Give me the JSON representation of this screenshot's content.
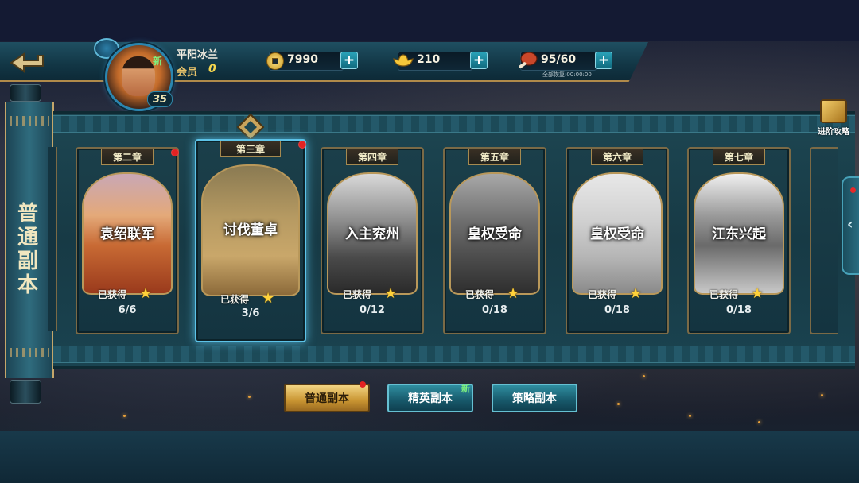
{
  "player": {
    "name": "平阳冰兰",
    "vip_label": "会员",
    "vip_level": "0",
    "level": "35",
    "avatar_badge": "新"
  },
  "resources": {
    "copper": {
      "value": "7990",
      "icon": "coin-icon"
    },
    "gold": {
      "value": "210",
      "icon": "gold-ingot-icon"
    },
    "stamina": {
      "value": "95/60",
      "recover_text": "全部恢复:00:00:00",
      "icon": "meat-icon"
    }
  },
  "panel": {
    "mode_title": "普通副本",
    "guide_label": "进阶攻略"
  },
  "chapters": [
    {
      "chapter": "第二章",
      "name": "袁绍联军",
      "obtained_label": "已获得",
      "progress": "6/6",
      "red_dot": true,
      "state": "cleared"
    },
    {
      "chapter": "第三章",
      "name": "讨伐董卓",
      "obtained_label": "已获得",
      "progress": "3/6",
      "red_dot": true,
      "state": "selected"
    },
    {
      "chapter": "第四章",
      "name": "入主兖州",
      "obtained_label": "已获得",
      "progress": "0/12",
      "red_dot": false,
      "state": "locked"
    },
    {
      "chapter": "第五章",
      "name": "皇权受命",
      "obtained_label": "已获得",
      "progress": "0/18",
      "red_dot": false,
      "state": "locked"
    },
    {
      "chapter": "第六章",
      "name": "皇权受命",
      "obtained_label": "已获得",
      "progress": "0/18",
      "red_dot": false,
      "state": "locked"
    },
    {
      "chapter": "第七章",
      "name": "江东兴起",
      "obtained_label": "已获得",
      "progress": "0/18",
      "red_dot": false,
      "state": "locked"
    }
  ],
  "mode_buttons": [
    {
      "label": "普通副本",
      "active": true,
      "red_dot": true
    },
    {
      "label": "精英副本",
      "active": false,
      "badge": "新"
    },
    {
      "label": "策略副本",
      "active": false
    }
  ],
  "colors": {
    "panel_teal": "#1d4652",
    "gold_frame": "#b9985a",
    "selected_glow": "#5dc3e8",
    "red_dot": "#e32222"
  }
}
